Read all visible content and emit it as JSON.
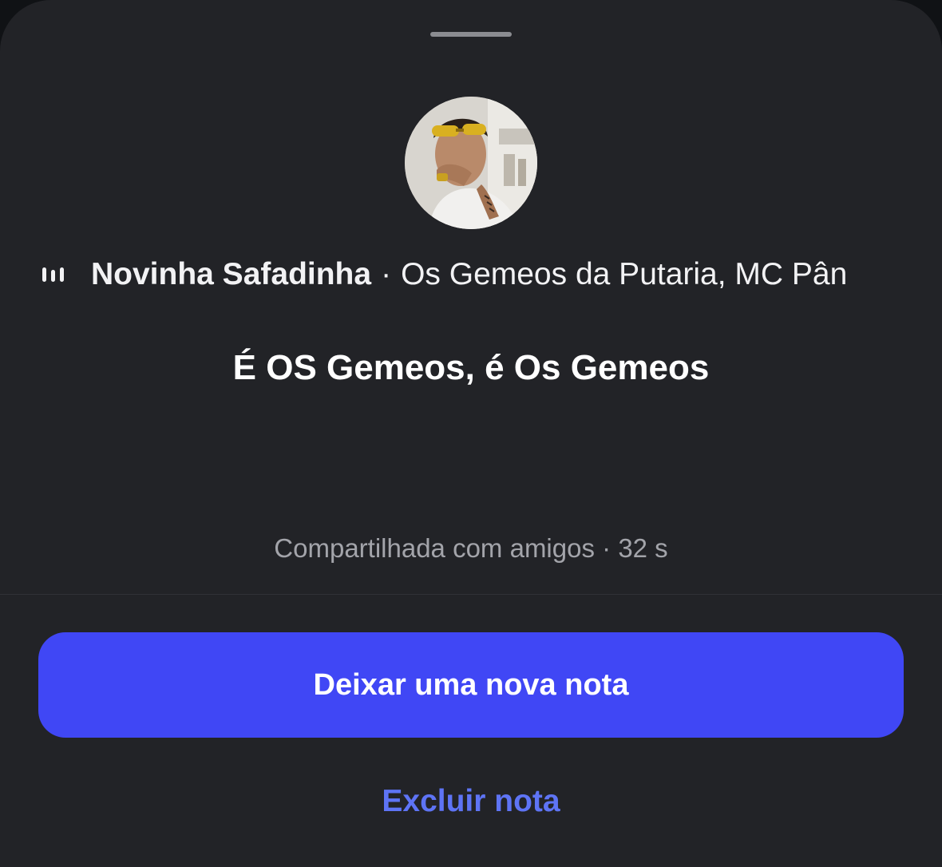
{
  "sheet": {
    "background_color": "#222327"
  },
  "avatar": {
    "icon": "profile-photo"
  },
  "music": {
    "icon": "audio-bars-icon",
    "title": "Novinha Safadinha",
    "separator": "·",
    "artists": "Os Gemeos da Putaria, MC Pân"
  },
  "note": {
    "text": "É OS Gemeos, é Os Gemeos"
  },
  "meta": {
    "shared_with": "Compartilhada com amigos",
    "separator": "·",
    "time_ago": "32 s"
  },
  "actions": {
    "new_note_label": "Deixar uma nova nota",
    "new_note_color": "#4047f5",
    "delete_note_label": "Excluir nota",
    "delete_note_color": "#5e74f5"
  }
}
